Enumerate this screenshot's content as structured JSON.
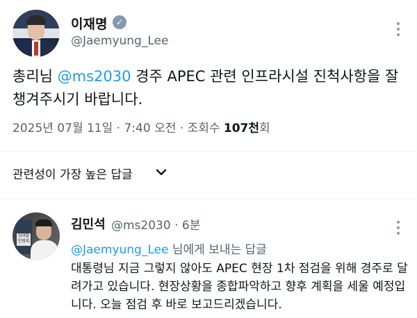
{
  "author": {
    "name": "이재명",
    "handle": "@Jaemyung_Lee"
  },
  "tweet": {
    "text_before": "총리님 ",
    "mention": "@ms2030",
    "text_after": " 경주 APEC 관련 인프라시설 진척사항을 잘 챙겨주시기 바랍니다.",
    "date": "2025년 07월 11일",
    "sep1": " · ",
    "time": "7:40 오전",
    "sep2": " · ",
    "views_label": "조회수 ",
    "views_value": "107천",
    "views_suffix": "회"
  },
  "replies_sort": {
    "label": "관련성이 가장 높은 답글"
  },
  "reply": {
    "name": "김민석",
    "handle_time": "@ms2030 · 6분",
    "to_mention": "@Jaemyung_Lee",
    "to_suffix": " 님에게 보내는 답글",
    "text": "대통령님 지금 그렇지 않아도 APEC 현장 1차 점검을 위해 경주로 달려가고 있습니다. 현장상황을 종합파악하고 향후 계획을 세울 예정입니다. 오늘 점검 후 바로 보고드리겠습니다.",
    "avatar_sign_text": "김대발 인형회"
  },
  "colors": {
    "link": "#1d9bf0",
    "secondary": "#536471",
    "primary": "#0f1419"
  }
}
